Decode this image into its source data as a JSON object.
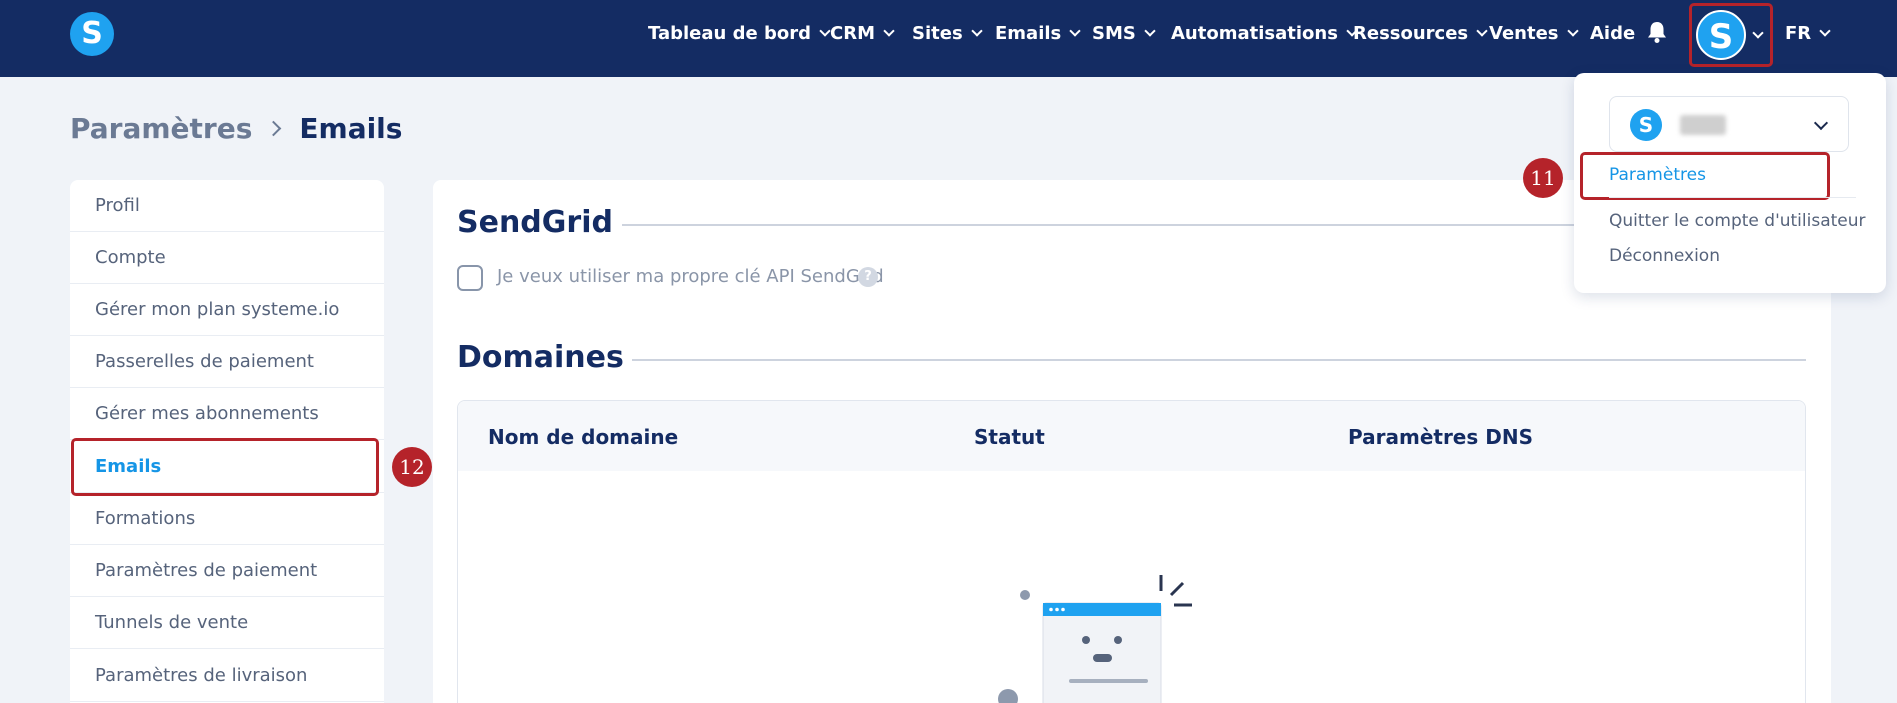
{
  "brand": {
    "logo_letter": "S"
  },
  "nav": {
    "items": [
      {
        "label": "Tableau de bord",
        "has_chevron": true
      },
      {
        "label": "CRM",
        "has_chevron": true
      },
      {
        "label": "Sites",
        "has_chevron": true
      },
      {
        "label": "Emails",
        "has_chevron": true
      },
      {
        "label": "SMS",
        "has_chevron": true
      },
      {
        "label": "Automatisations",
        "has_chevron": true
      },
      {
        "label": "Ressources",
        "has_chevron": true
      },
      {
        "label": "Ventes",
        "has_chevron": true
      },
      {
        "label": "Aide",
        "has_chevron": false
      }
    ],
    "bell_icon": "bell-icon",
    "avatar_letter": "S",
    "language": "FR"
  },
  "breadcrumb": {
    "parent": "Paramètres",
    "current": "Emails"
  },
  "sidebar": {
    "items": [
      {
        "label": "Profil",
        "active": false
      },
      {
        "label": "Compte",
        "active": false
      },
      {
        "label": "Gérer mon plan systeme.io",
        "active": false
      },
      {
        "label": "Passerelles de paiement",
        "active": false
      },
      {
        "label": "Gérer mes abonnements",
        "active": false
      },
      {
        "label": "Emails",
        "active": true
      },
      {
        "label": "Formations",
        "active": false
      },
      {
        "label": "Paramètres de paiement",
        "active": false
      },
      {
        "label": "Tunnels de vente",
        "active": false
      },
      {
        "label": "Paramètres de livraison",
        "active": false
      }
    ]
  },
  "main": {
    "sendgrid": {
      "title": "SendGrid",
      "checkbox_label": "Je veux utiliser ma propre clé API SendGrid",
      "checked": false,
      "help_icon": "?"
    },
    "domains": {
      "title": "Domaines",
      "columns": [
        "Nom de domaine",
        "Statut",
        "Paramètres DNS"
      ],
      "rows": []
    }
  },
  "dropdown": {
    "account_logo_letter": "S",
    "items": [
      {
        "label": "Paramètres",
        "active": true
      },
      {
        "label": "Quitter le compte d'utilisateur",
        "active": false
      },
      {
        "label": "Déconnexion",
        "active": false
      }
    ]
  },
  "annotations": {
    "step_sidebar": "12",
    "step_dropdown": "11"
  },
  "colors": {
    "topbar": "#142c63",
    "accent": "#1fa2f0",
    "link_active": "#1595e6",
    "highlight_red": "#b5232a",
    "page_bg": "#f0f3f8"
  }
}
